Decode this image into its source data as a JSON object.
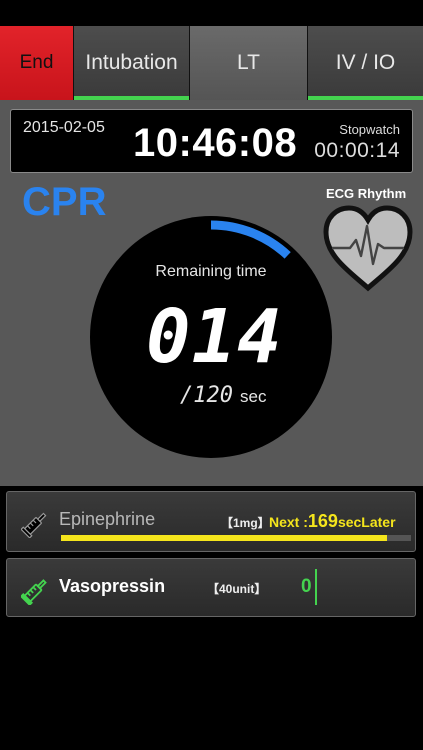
{
  "tabs": {
    "end": "End",
    "intubation": "Intubation",
    "lt": "LT",
    "ivio": "IV / IO"
  },
  "clock": {
    "date": "2015-02-05",
    "time": "10:46:08",
    "stopwatch_label": "Stopwatch",
    "stopwatch_value": "00:00:14"
  },
  "cpr": {
    "label": "CPR",
    "remaining_label": "Remaining time",
    "count_ghost": "0",
    "count_value": "14",
    "total": "/120",
    "unit": "sec",
    "progress_fraction": 0.12
  },
  "ecg": {
    "label": "ECG Rhythm",
    "icon": "heart-ecg-icon"
  },
  "drugs": {
    "epinephrine": {
      "name": "Epinephrine",
      "dose": "【1mg】",
      "next_label": "Next :",
      "next_value": "169",
      "next_unit": "secLater",
      "progress_fraction": 0.93
    },
    "vasopressin": {
      "name": "Vasopressin",
      "dose": "【40unit】",
      "count": "0"
    }
  },
  "colors": {
    "end_red": "#e2232a",
    "active_green": "#44d34f",
    "cpr_blue": "#2a83ef",
    "next_yellow": "#f5e51c"
  }
}
